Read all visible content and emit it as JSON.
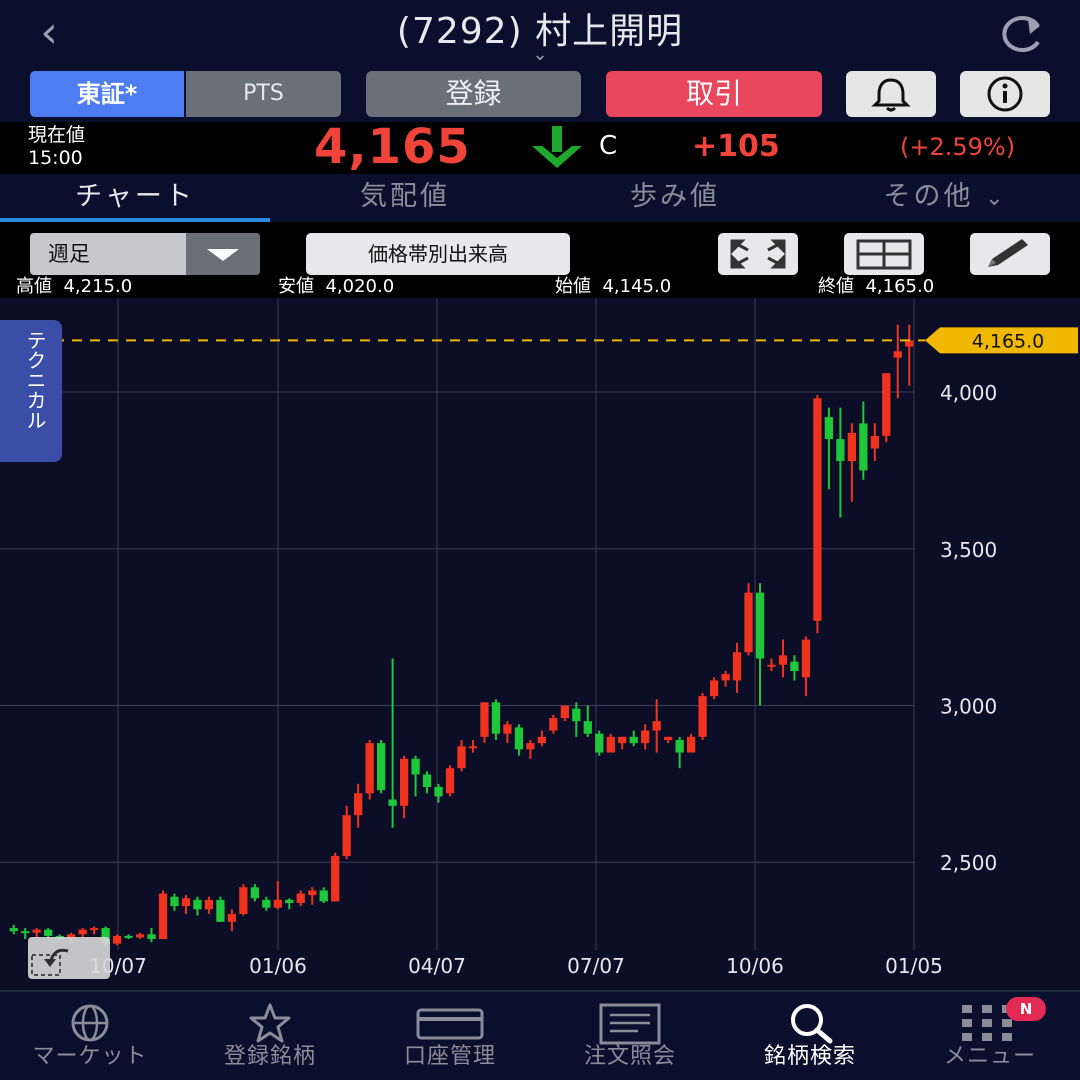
{
  "header": {
    "back_icon": "back-chevron-icon",
    "title": "(7292) 村上開明",
    "refresh_icon": "refresh-icon"
  },
  "actions": {
    "tosho": "東証*",
    "pts": "PTS",
    "register": "登録",
    "trade": "取引",
    "bell_icon": "bell-icon",
    "info_icon": "info-icon"
  },
  "price": {
    "label": "現在値",
    "time": "15:00",
    "value": "4,165",
    "direction": "down",
    "flag": "C",
    "change": "+105",
    "change_pct": "(+2.59%)"
  },
  "tabs": [
    {
      "label": "チャート",
      "active": true
    },
    {
      "label": "気配値",
      "active": false
    },
    {
      "label": "歩み値",
      "active": false
    },
    {
      "label": "その他",
      "active": false
    }
  ],
  "toolbar": {
    "period": "週足",
    "volume_by_price": "価格帯別出来高"
  },
  "ohlc": {
    "high_label": "高値",
    "high": "4,215.0",
    "low_label": "安値",
    "low": "4,020.0",
    "open_label": "始値",
    "open": "4,145.0",
    "close_label": "終値",
    "close": "4,165.0"
  },
  "technical_tab": "テクニカル",
  "colors": {
    "up": "#f0331f",
    "down": "#1fc83a",
    "accent": "#4d7df0",
    "price_tag": "#f0b800"
  },
  "chart_data": {
    "type": "candlestick",
    "period": "weekly",
    "ylim": [
      2220,
      4300
    ],
    "yticks": [
      2500,
      3000,
      3500,
      4000
    ],
    "ytick_labels": [
      "2,500",
      "3,000",
      "3,500",
      "4,000"
    ],
    "xtick_labels": [
      "10/07",
      "01/06",
      "04/07",
      "07/07",
      "10/06",
      "01/05"
    ],
    "current_price": 4165,
    "current_price_label": "4,165.0",
    "candles": [
      [
        2290,
        2300,
        2270,
        2280
      ],
      [
        2280,
        2290,
        2255,
        2275
      ],
      [
        2275,
        2290,
        2260,
        2285
      ],
      [
        2285,
        2290,
        2250,
        2265
      ],
      [
        2265,
        2270,
        2250,
        2255
      ],
      [
        2255,
        2275,
        2245,
        2270
      ],
      [
        2270,
        2290,
        2260,
        2285
      ],
      [
        2285,
        2295,
        2270,
        2290
      ],
      [
        2290,
        2295,
        2230,
        2240
      ],
      [
        2240,
        2270,
        2235,
        2265
      ],
      [
        2265,
        2270,
        2255,
        2260
      ],
      [
        2260,
        2275,
        2255,
        2270
      ],
      [
        2270,
        2290,
        2245,
        2255
      ],
      [
        2255,
        2410,
        2255,
        2400
      ],
      [
        2390,
        2400,
        2345,
        2360
      ],
      [
        2360,
        2395,
        2335,
        2385
      ],
      [
        2380,
        2390,
        2330,
        2350
      ],
      [
        2350,
        2390,
        2335,
        2380
      ],
      [
        2380,
        2390,
        2310,
        2310
      ],
      [
        2310,
        2350,
        2280,
        2335
      ],
      [
        2335,
        2430,
        2330,
        2420
      ],
      [
        2420,
        2430,
        2375,
        2385
      ],
      [
        2380,
        2390,
        2345,
        2355
      ],
      [
        2355,
        2440,
        2350,
        2380
      ],
      [
        2380,
        2385,
        2350,
        2370
      ],
      [
        2370,
        2410,
        2360,
        2400
      ],
      [
        2395,
        2420,
        2365,
        2410
      ],
      [
        2410,
        2420,
        2370,
        2375
      ],
      [
        2375,
        2530,
        2375,
        2520
      ],
      [
        2520,
        2680,
        2510,
        2650
      ],
      [
        2650,
        2750,
        2610,
        2720
      ],
      [
        2720,
        2890,
        2700,
        2880
      ],
      [
        2880,
        2890,
        2720,
        2730
      ],
      [
        2700,
        3150,
        2610,
        2680
      ],
      [
        2680,
        2840,
        2640,
        2830
      ],
      [
        2830,
        2840,
        2710,
        2780
      ],
      [
        2780,
        2790,
        2720,
        2740
      ],
      [
        2740,
        2750,
        2690,
        2710
      ],
      [
        2720,
        2810,
        2710,
        2800
      ],
      [
        2800,
        2890,
        2790,
        2870
      ],
      [
        2870,
        2890,
        2850,
        2870
      ],
      [
        2900,
        3010,
        2880,
        3010
      ],
      [
        3010,
        3020,
        2890,
        2910
      ],
      [
        2910,
        2950,
        2880,
        2940
      ],
      [
        2930,
        2940,
        2840,
        2860
      ],
      [
        2860,
        2890,
        2830,
        2880
      ],
      [
        2880,
        2920,
        2870,
        2900
      ],
      [
        2920,
        2970,
        2910,
        2960
      ],
      [
        2960,
        3000,
        2950,
        3000
      ],
      [
        2990,
        3010,
        2900,
        2950
      ],
      [
        2950,
        3000,
        2900,
        2910
      ],
      [
        2910,
        2920,
        2840,
        2850
      ],
      [
        2850,
        2910,
        2850,
        2900
      ],
      [
        2880,
        2900,
        2860,
        2900
      ],
      [
        2900,
        2920,
        2870,
        2880
      ],
      [
        2880,
        2940,
        2860,
        2920
      ],
      [
        2920,
        3020,
        2850,
        2950
      ],
      [
        2890,
        2900,
        2880,
        2900
      ],
      [
        2890,
        2900,
        2800,
        2850
      ],
      [
        2850,
        2910,
        2850,
        2900
      ],
      [
        2900,
        3040,
        2890,
        3030
      ],
      [
        3030,
        3090,
        3020,
        3080
      ],
      [
        3080,
        3110,
        3060,
        3100
      ],
      [
        3080,
        3200,
        3040,
        3170
      ],
      [
        3170,
        3390,
        3160,
        3360
      ],
      [
        3360,
        3390,
        3000,
        3150
      ],
      [
        3130,
        3150,
        3110,
        3130
      ],
      [
        3130,
        3210,
        3090,
        3160
      ],
      [
        3140,
        3160,
        3080,
        3110
      ],
      [
        3090,
        3220,
        3030,
        3210
      ],
      [
        3270,
        3990,
        3230,
        3980
      ],
      [
        3920,
        3950,
        3690,
        3850
      ],
      [
        3850,
        3950,
        3600,
        3780
      ],
      [
        3780,
        3900,
        3650,
        3870
      ],
      [
        3900,
        3970,
        3720,
        3750
      ],
      [
        3820,
        3900,
        3780,
        3860
      ],
      [
        3860,
        4060,
        3840,
        4060
      ],
      [
        4110,
        4215,
        3980,
        4130
      ],
      [
        4145,
        4215,
        4020,
        4165
      ]
    ]
  },
  "bottom_nav": [
    {
      "label": "マーケット",
      "icon": "globe-icon",
      "active": false
    },
    {
      "label": "登録銘柄",
      "icon": "star-icon",
      "active": false
    },
    {
      "label": "口座管理",
      "icon": "card-icon",
      "active": false
    },
    {
      "label": "注文照会",
      "icon": "document-icon",
      "active": false
    },
    {
      "label": "銘柄検索",
      "icon": "search-icon",
      "active": true
    },
    {
      "label": "メニュー",
      "icon": "grid-menu-icon",
      "active": false
    }
  ],
  "badge": "N"
}
